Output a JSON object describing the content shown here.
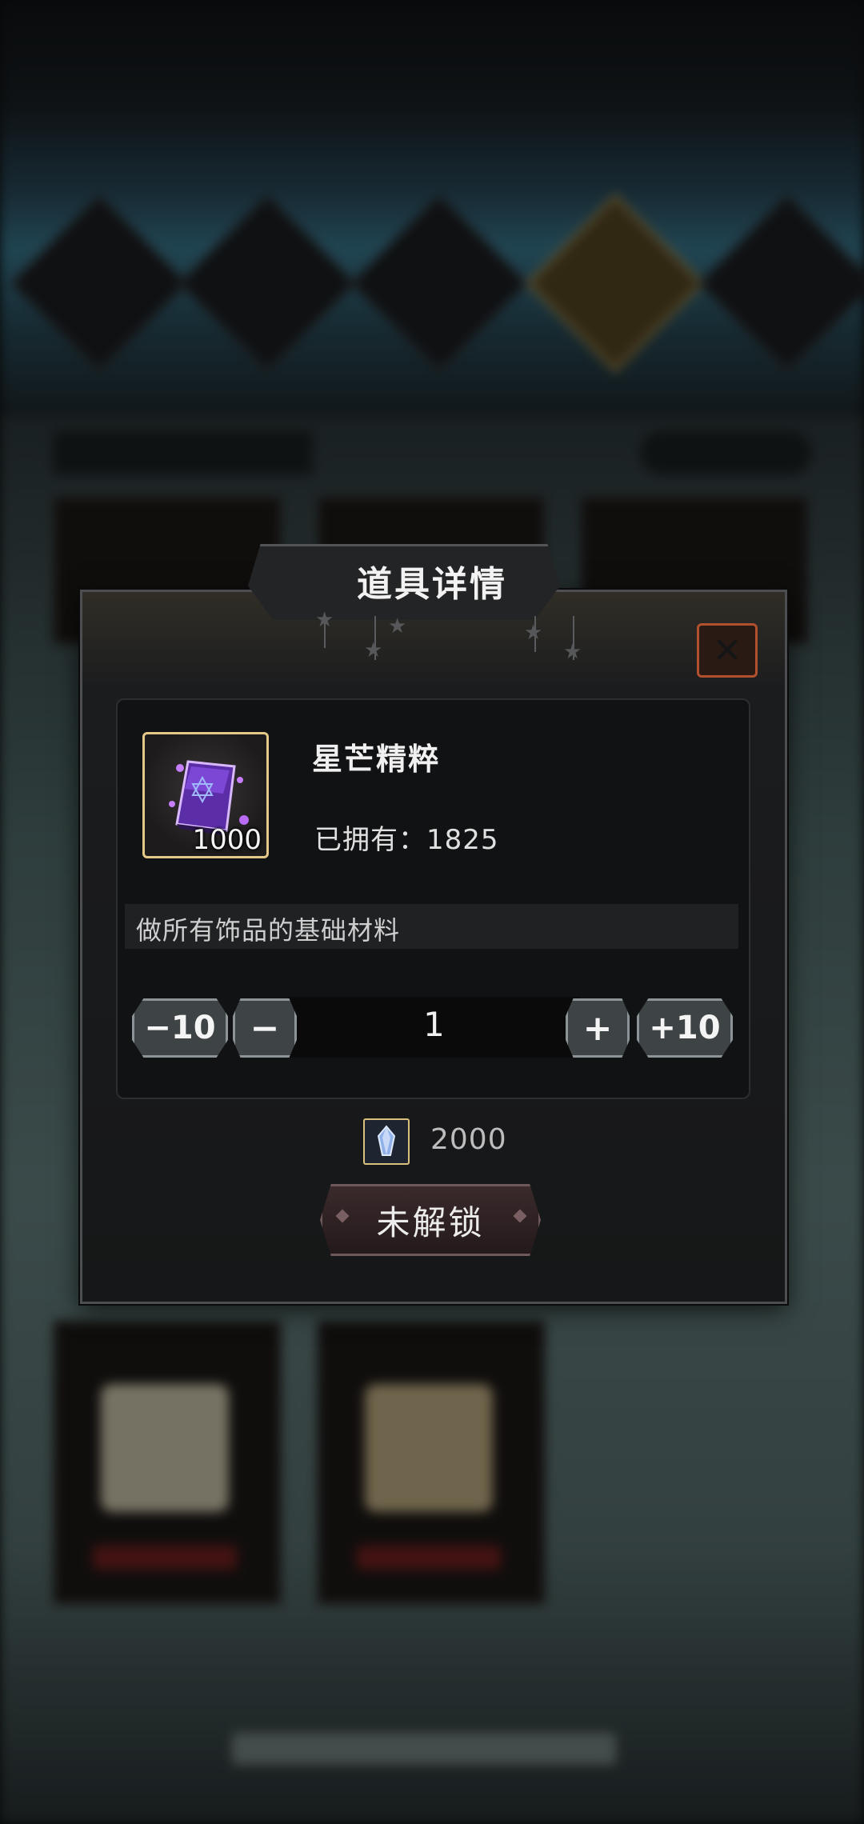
{
  "dialog": {
    "title": "道具详情",
    "item": {
      "name": "星芒精粹",
      "icon_count": "1000",
      "owned_label": "已拥有：",
      "owned_value": "1825",
      "description": "做所有饰品的基础材料",
      "icon": "purple-crystal-icon"
    },
    "quantity": {
      "minus10": "−10",
      "minus": "−",
      "value": "1",
      "plus": "+",
      "plus10": "+10"
    },
    "cost": {
      "icon": "blue-crystal-icon",
      "value": "2000"
    },
    "action_label": "未解锁",
    "close_icon": "close-icon"
  },
  "colors": {
    "accent_gold": "#e3c88a",
    "close_border": "#b0502e"
  }
}
